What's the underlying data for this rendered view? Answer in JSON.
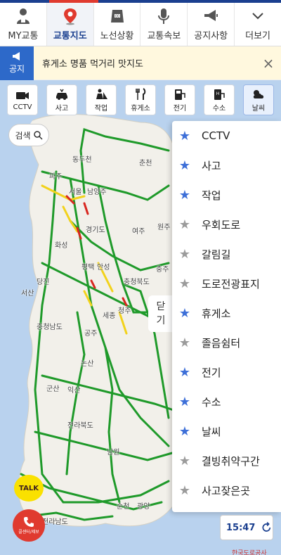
{
  "tabs": [
    {
      "label": "MY교통",
      "icon": "user-icon"
    },
    {
      "label": "교통지도",
      "icon": "map-pin-icon"
    },
    {
      "label": "노선상황",
      "icon": "route-icon"
    },
    {
      "label": "교통속보",
      "icon": "microphone-icon"
    },
    {
      "label": "공지사항",
      "icon": "megaphone-icon"
    },
    {
      "label": "더보기",
      "icon": "chevron-down-icon"
    }
  ],
  "active_tab": "교통지도",
  "notice": {
    "badge": "공지",
    "text": "휴게소 명품 먹거리 맛지도"
  },
  "filters": [
    {
      "label": "CCTV",
      "icon": "camera-icon"
    },
    {
      "label": "사고",
      "icon": "accident-icon"
    },
    {
      "label": "작업",
      "icon": "worker-icon"
    },
    {
      "label": "휴게소",
      "icon": "fork-knife-icon"
    },
    {
      "label": "전기",
      "icon": "ev-charger-icon"
    },
    {
      "label": "수소",
      "icon": "hydrogen-icon"
    },
    {
      "label": "날씨",
      "icon": "weather-icon"
    }
  ],
  "search": {
    "label": "검색"
  },
  "close_hint": {
    "line1": "닫",
    "line2": "기"
  },
  "layer_menu": [
    {
      "label": "CCTV",
      "checked": true
    },
    {
      "label": "사고",
      "checked": true
    },
    {
      "label": "작업",
      "checked": true
    },
    {
      "label": "우회도로",
      "checked": false
    },
    {
      "label": "갈림길",
      "checked": false
    },
    {
      "label": "도로전광표지",
      "checked": false
    },
    {
      "label": "휴게소",
      "checked": true
    },
    {
      "label": "졸음쉼터",
      "checked": false
    },
    {
      "label": "전기",
      "checked": true
    },
    {
      "label": "수소",
      "checked": true
    },
    {
      "label": "날씨",
      "checked": true
    },
    {
      "label": "결빙취약구간",
      "checked": false
    },
    {
      "label": "사고잦은곳",
      "checked": false
    }
  ],
  "map_labels": [
    "동두천",
    "춘천",
    "파주",
    "서울",
    "남양주",
    "경기도",
    "원주",
    "여주",
    "화성",
    "평택",
    "안성",
    "충주",
    "충청북도",
    "서산",
    "당진",
    "세종",
    "청주",
    "충청남도",
    "공주",
    "논산",
    "군산",
    "익산",
    "전라북도",
    "남원",
    "순천",
    "광양",
    "전라남도"
  ],
  "kakao": {
    "label": "TALK"
  },
  "call": {
    "label": "콜센터/제보"
  },
  "time": {
    "label": "15:47"
  },
  "footer_logo": "한국도로공사",
  "colors": {
    "primary": "#1a3f8f",
    "accent_red": "#e03a2f",
    "road_green": "#1f9a2a",
    "road_yellow": "#f2d21b",
    "road_red": "#d8261f",
    "sea": "#b9d2ee",
    "land": "#f2f0ea",
    "star_on": "#3d6fd8",
    "star_off": "#9b9b9b"
  }
}
